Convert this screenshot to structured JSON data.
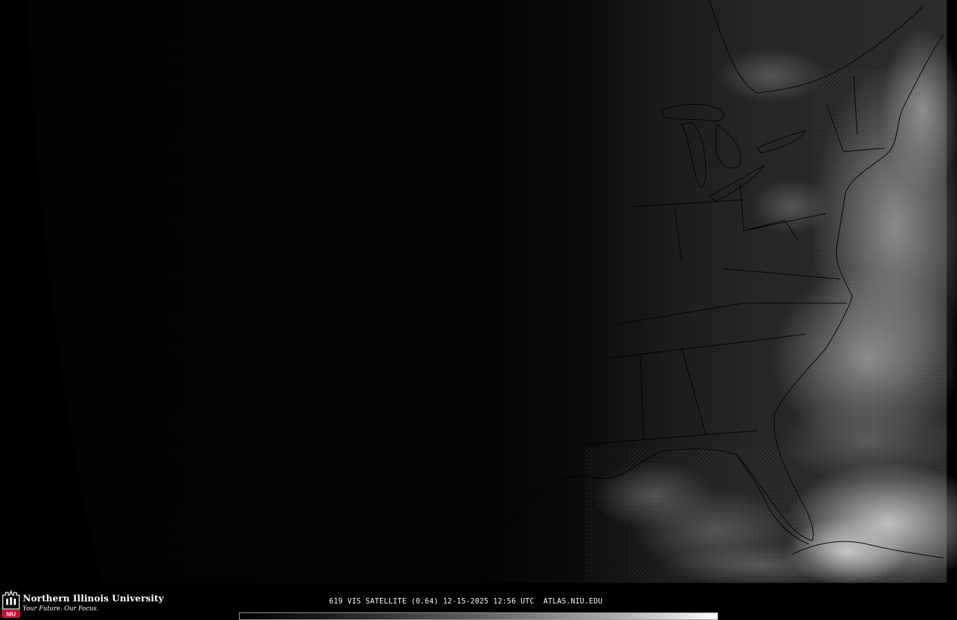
{
  "map": {
    "product": "VIS",
    "scale": "grayscale",
    "ocean_brightness": "bright clouds east",
    "colors": {
      "background": "#000000",
      "land_night": "#050505",
      "land_day": "#232323",
      "cloud": "#a8a8a8",
      "boundary": "#000000"
    }
  },
  "footer": {
    "university_name": "Northern Illinois University",
    "tagline": "Your Future. Our Focus.",
    "logo_text": "NIU",
    "caption": "619 VIS SATELLITE (0.64) 12-15-2025 12:56 UTC  ATLAS.NIU.EDU",
    "colorbar": {
      "min_color": "#000000",
      "max_color": "#ffffff"
    }
  }
}
